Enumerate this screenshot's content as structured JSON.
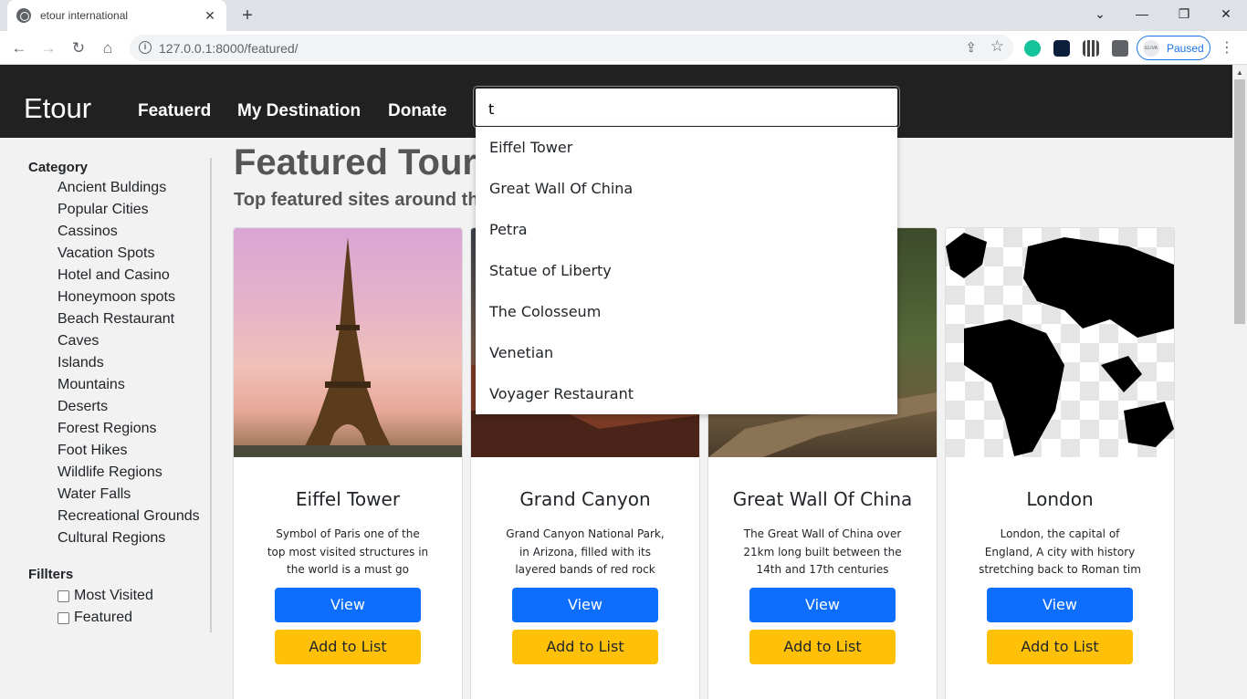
{
  "browser": {
    "tab_title": "etour international",
    "tab_close": "✕",
    "new_tab": "+",
    "url": "127.0.0.1:8000/featured/",
    "paused_label": "Paused",
    "avatar_text": "ELIVA",
    "window_controls": [
      "⌄",
      "—",
      "❐",
      "✕"
    ],
    "nav_glyphs": {
      "back": "←",
      "forward": "→",
      "reload": "↻",
      "home": "⌂"
    },
    "share": "⇪",
    "star": "☆",
    "menu": "⋮"
  },
  "site": {
    "brand": "Etour",
    "nav": [
      "Featuerd",
      "My Destination",
      "Donate"
    ]
  },
  "search": {
    "value": "t",
    "suggestions": [
      "Eiffel Tower",
      "Great Wall Of China",
      "Petra",
      "Statue of Liberty",
      "The Colosseum",
      "Venetian",
      "Voyager Restaurant"
    ]
  },
  "sidebar": {
    "category_heading": "Category",
    "categories": [
      "Ancient Buldings",
      "Popular Cities",
      "Cassinos",
      "Vacation Spots",
      "Hotel and Casino",
      "Honeymoon spots",
      "Beach Restaurant",
      "Caves",
      "Islands",
      "Mountains",
      "Deserts",
      "Forest Regions",
      "Foot Hikes",
      "Wildlife Regions",
      "Water Falls",
      "Recreational Grounds",
      "Cultural Regions"
    ],
    "filters_heading": "Fillters",
    "filters": [
      "Most Visited",
      "Featured"
    ]
  },
  "main": {
    "title": "Featured Touris",
    "subtitle": "Top featured sites around the"
  },
  "cards": [
    {
      "title": "Eiffel Tower",
      "desc": "Symbol of Paris one of the top most visited structures in the world is a must go",
      "view": "View",
      "add": "Add to List"
    },
    {
      "title": "Grand Canyon",
      "desc": "Grand Canyon National Park, in Arizona, filled with its layered bands of red rock",
      "view": "View",
      "add": "Add to List"
    },
    {
      "title": "Great Wall Of China",
      "desc": "The Great Wall of China over 21km long built between the 14th and 17th centuries",
      "view": "View",
      "add": "Add to List"
    },
    {
      "title": "London",
      "desc": "London, the capital of England, A city with history stretching back to Roman tim",
      "view": "View",
      "add": "Add to List"
    }
  ],
  "colors": {
    "primary": "#0d6efd",
    "warning": "#ffc107",
    "nav_bg": "#212121"
  }
}
